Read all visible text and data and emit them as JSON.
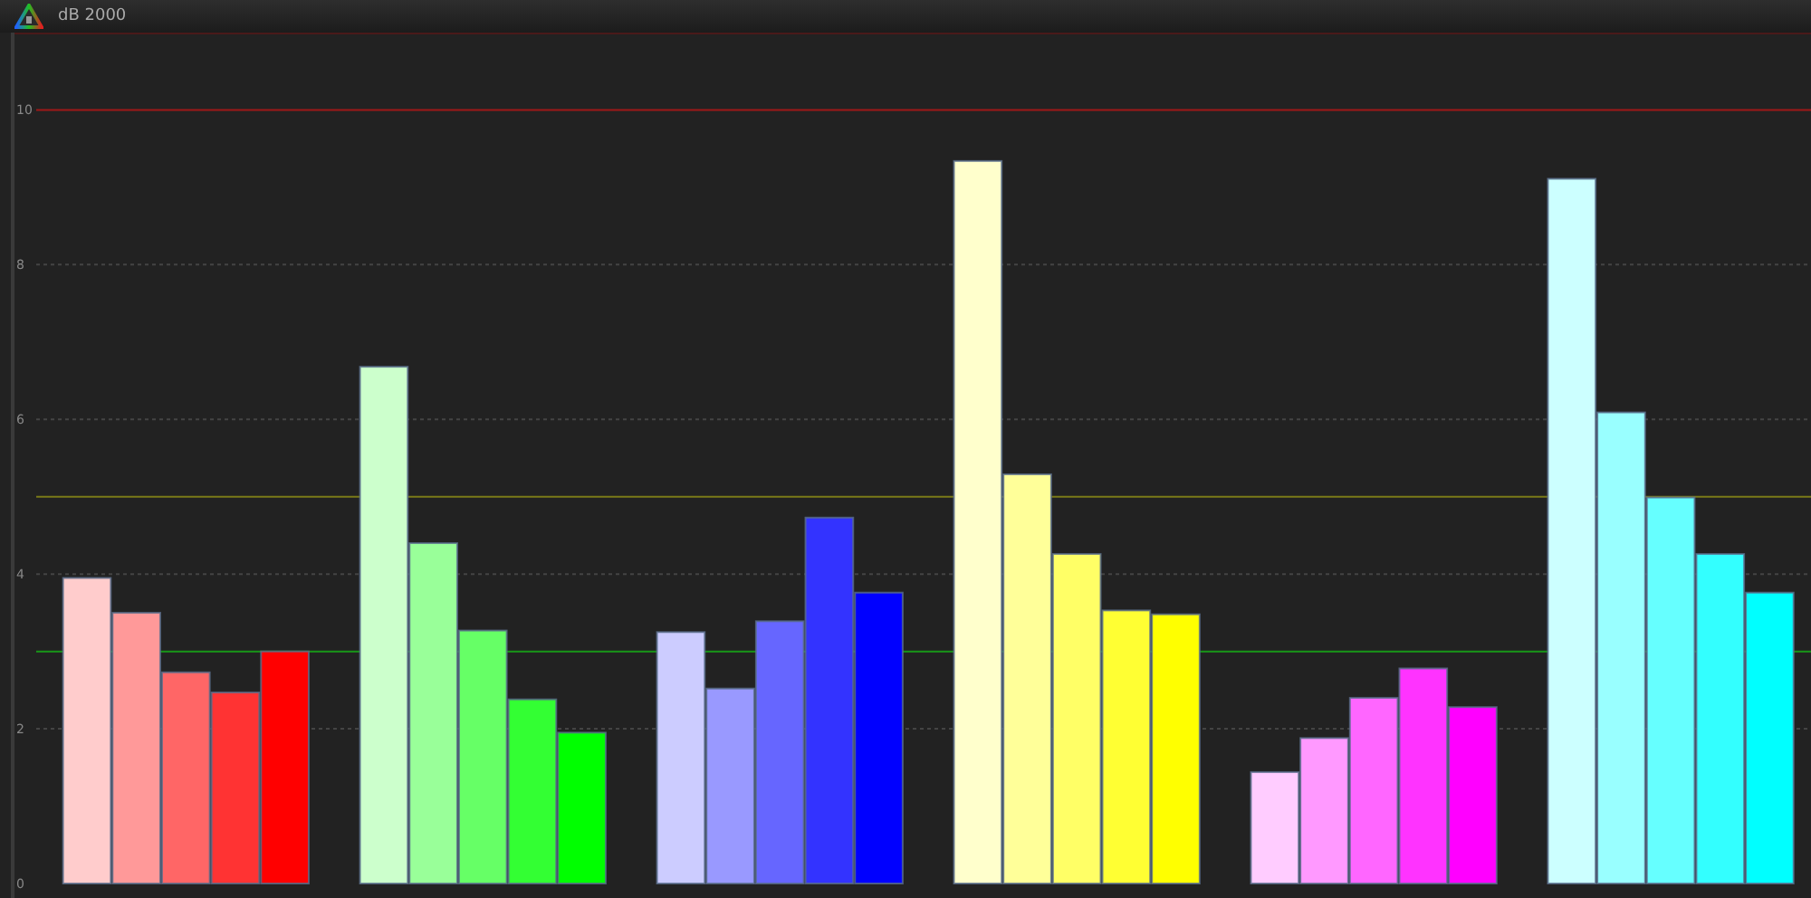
{
  "header": {
    "title": "dB  2000"
  },
  "chart_data": {
    "type": "bar",
    "ylim": [
      0,
      11
    ],
    "yticks": [
      0,
      2,
      4,
      6,
      8,
      10
    ],
    "grid": true,
    "values": [
      null,
      3.95,
      3.5,
      2.73,
      2.47,
      3.0,
      null,
      6.68,
      4.4,
      3.27,
      2.38,
      1.95,
      null,
      3.25,
      2.52,
      3.39,
      4.73,
      3.76,
      null,
      9.34,
      5.29,
      4.26,
      3.53,
      3.48,
      null,
      1.44,
      1.88,
      2.4,
      2.78,
      2.28,
      null,
      9.11,
      6.09,
      4.99,
      4.26,
      3.76
    ],
    "ref_lines": [
      {
        "axis": "y",
        "value": 10,
        "color": "#a01818"
      },
      {
        "axis": "y",
        "value": 5,
        "color": "#7a7a18"
      },
      {
        "axis": "y",
        "value": 3,
        "color": "#189818"
      }
    ]
  }
}
